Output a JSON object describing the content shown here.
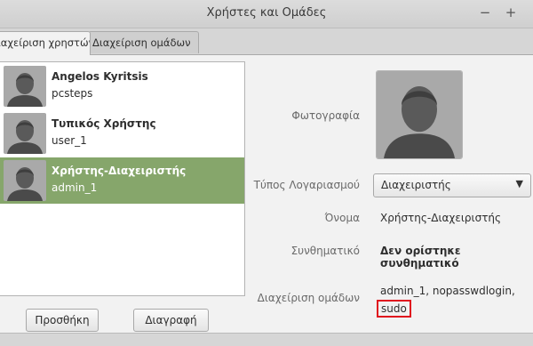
{
  "window": {
    "title": "Χρήστες και Ομάδες",
    "minimize_glyph": "−",
    "maximize_glyph": "+"
  },
  "tabs": [
    {
      "label": "Διαχείριση χρηστών",
      "active": true
    },
    {
      "label": "Διαχείριση ομάδων",
      "active": false
    }
  ],
  "users": [
    {
      "name": "Angelos Kyritsis",
      "login": "pcsteps",
      "selected": false
    },
    {
      "name": "Τυπικός Χρήστης",
      "login": "user_1",
      "selected": false
    },
    {
      "name": "Χρήστης-Διαχειριστής",
      "login": "admin_1",
      "selected": true
    }
  ],
  "buttons": {
    "add": "Προσθήκη",
    "delete": "Διαγραφή"
  },
  "details": {
    "photo_label": "Φωτογραφία",
    "account_type_label": "Τύπος Λογαριασμού",
    "account_type_value": "Διαχειριστής",
    "name_label": "Όνομα",
    "name_value": "Χρήστης-Διαχειριστής",
    "password_label": "Συνθηματικό",
    "password_value": "Δεν ορίστηκε συνθηματικό",
    "groups_label": "Διαχείριση ομάδων",
    "groups_value": "admin_1, nopasswdlogin,",
    "groups_highlight": "sudo"
  },
  "colors": {
    "selection": "#86a66b",
    "highlight_border": "#e0141e"
  }
}
